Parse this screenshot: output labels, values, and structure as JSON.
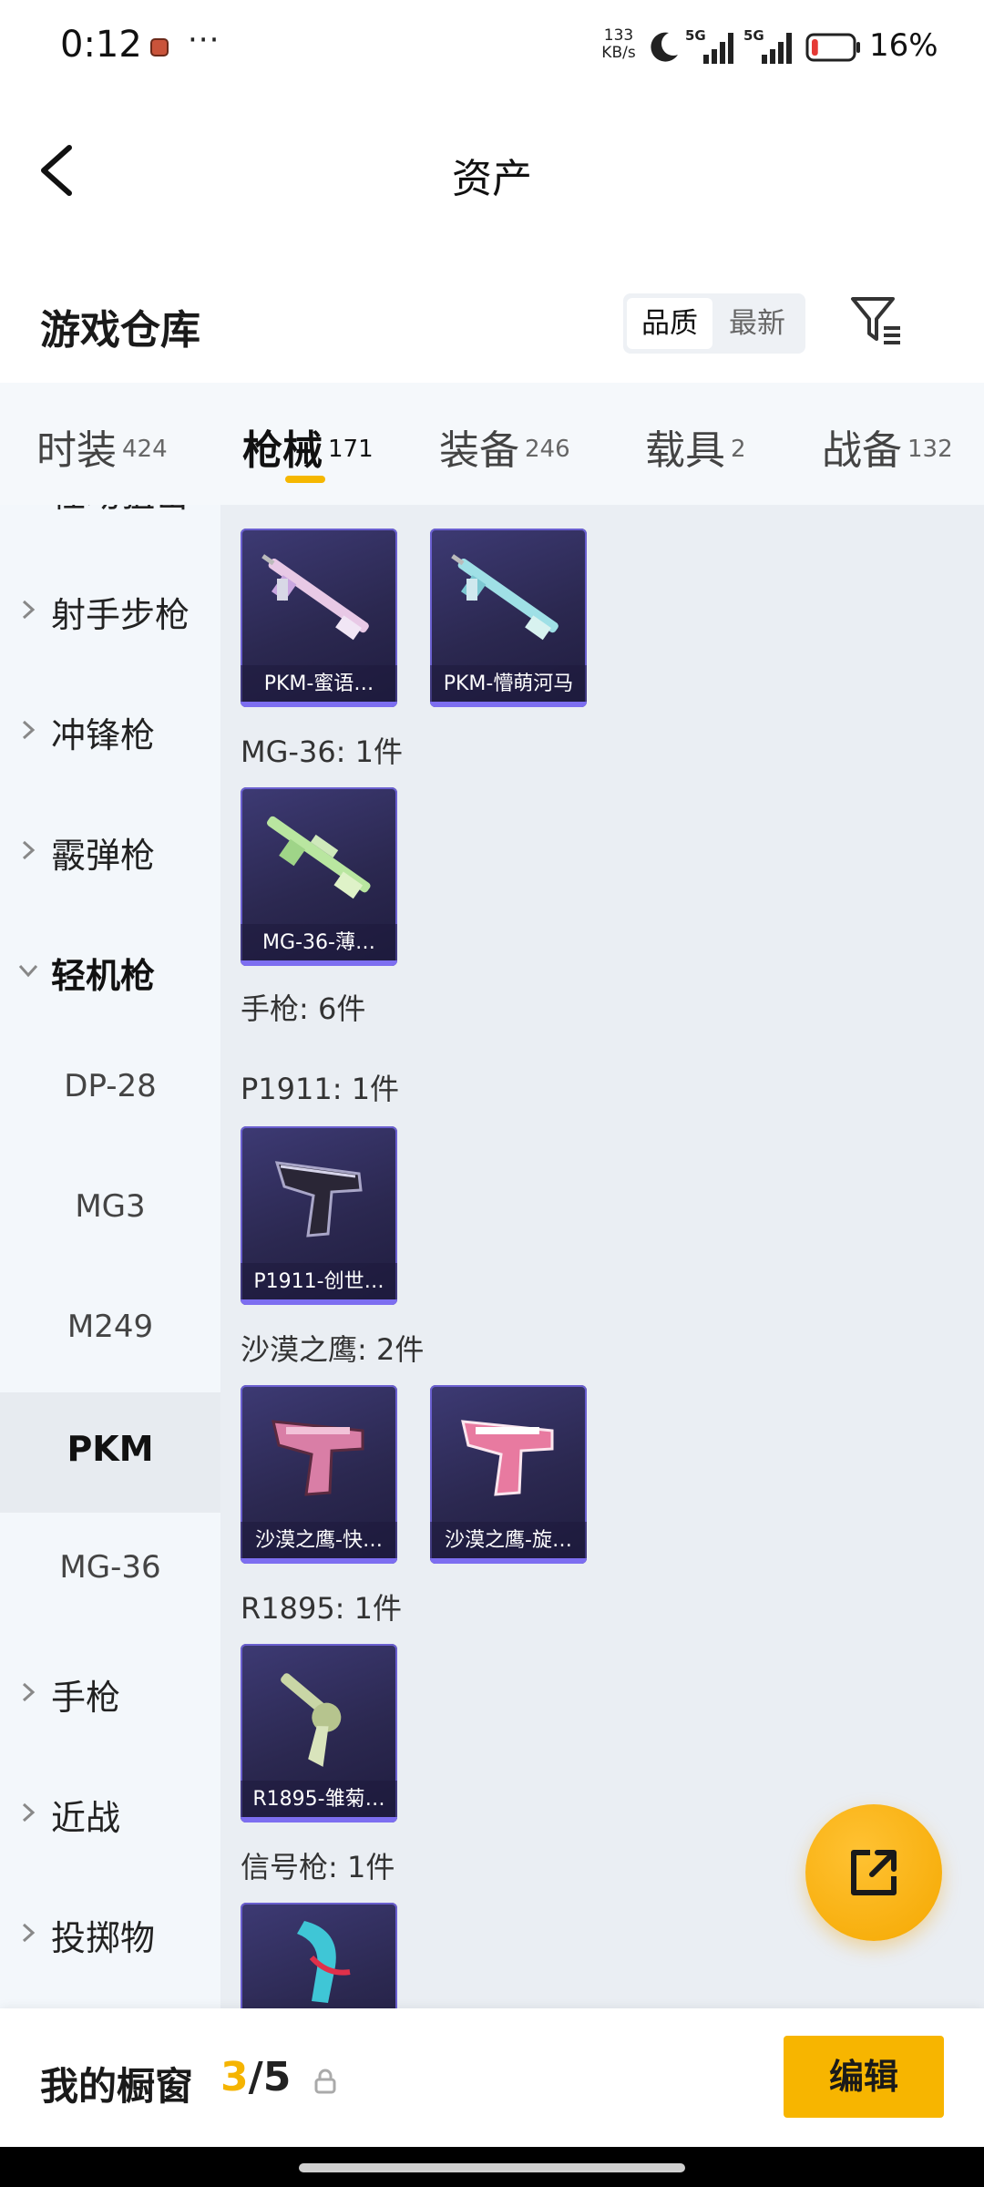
{
  "status_bar": {
    "time": "0:12",
    "more": "···",
    "net_speed_value": "133",
    "net_speed_unit": "KB/s",
    "network1": "5G",
    "network2": "5G",
    "battery": "16%",
    "battery_level": 0.16,
    "battery_color": "#e53935"
  },
  "header": {
    "title": "资产"
  },
  "section": {
    "title": "游戏仓库",
    "sort_options": [
      "品质",
      "最新"
    ],
    "selected_sort": "品质"
  },
  "tabs": [
    {
      "label": "时装",
      "count": "424"
    },
    {
      "label": "枪械",
      "count": "171",
      "active": true
    },
    {
      "label": "装备",
      "count": "246"
    },
    {
      "label": "载具",
      "count": "2"
    },
    {
      "label": "战备",
      "count": "132"
    }
  ],
  "sidebar": {
    "items": [
      {
        "label": "栓动狙击",
        "type": "category",
        "expanded": false
      },
      {
        "label": "射手步枪",
        "type": "category",
        "expanded": false
      },
      {
        "label": "冲锋枪",
        "type": "category",
        "expanded": false
      },
      {
        "label": "霰弹枪",
        "type": "category",
        "expanded": false
      },
      {
        "label": "轻机枪",
        "type": "category",
        "expanded": true
      },
      {
        "label": "DP-28",
        "type": "sub"
      },
      {
        "label": "MG3",
        "type": "sub"
      },
      {
        "label": "M249",
        "type": "sub"
      },
      {
        "label": "PKM",
        "type": "sub",
        "active": true
      },
      {
        "label": "MG-36",
        "type": "sub"
      },
      {
        "label": "手枪",
        "type": "category",
        "expanded": false
      },
      {
        "label": "近战",
        "type": "category",
        "expanded": false
      },
      {
        "label": "投掷物",
        "type": "category",
        "expanded": false
      }
    ]
  },
  "content": {
    "groups": [
      {
        "label": "",
        "items": [
          "PKM-蜜语…",
          "PKM-懵萌河马"
        ]
      },
      {
        "label": "MG-36: 1件",
        "items": [
          "MG-36-薄…"
        ]
      },
      {
        "label": "手枪: 6件",
        "items": []
      },
      {
        "label": "P1911: 1件",
        "items": [
          "P1911-创世…"
        ]
      },
      {
        "label": "沙漠之鹰: 2件",
        "items": [
          "沙漠之鹰-快…",
          "沙漠之鹰-旋…"
        ]
      },
      {
        "label": "R1895: 1件",
        "items": [
          "R1895-雏菊…"
        ]
      },
      {
        "label": "信号枪: 1件",
        "items": [
          ""
        ]
      }
    ]
  },
  "bottom_bar": {
    "label": "我的橱窗",
    "count_current": "3",
    "count_sep": "/",
    "count_total": "5",
    "edit_label": "编辑"
  },
  "colors": {
    "accent": "#f5b700",
    "card_border": "#6a5fcf"
  }
}
